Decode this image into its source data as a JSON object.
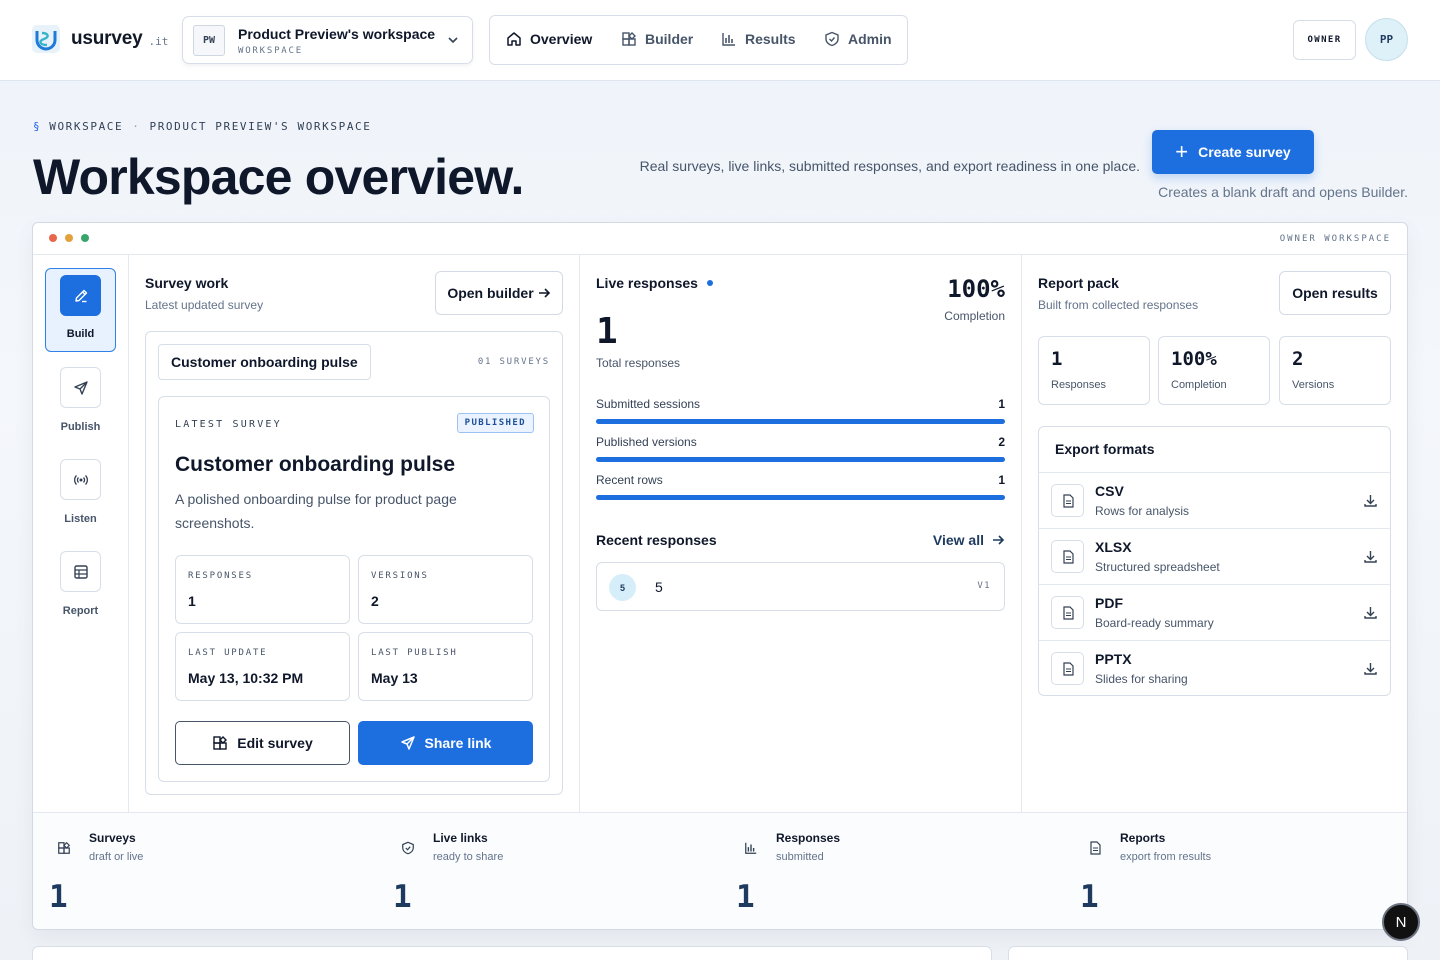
{
  "brand": {
    "name": "usurvey",
    "tld": ".it"
  },
  "workspace_switcher": {
    "initials": "PW",
    "name": "Product Preview's workspace",
    "caption": "WORKSPACE"
  },
  "nav": [
    {
      "label": "Overview",
      "icon": "home-icon",
      "active": true
    },
    {
      "label": "Builder",
      "icon": "blocks-icon",
      "active": false
    },
    {
      "label": "Results",
      "icon": "bar-chart-icon",
      "active": false
    },
    {
      "label": "Admin",
      "icon": "shield-icon",
      "active": false
    }
  ],
  "user": {
    "role": "OWNER",
    "initials": "PP"
  },
  "header": {
    "crumb_symbol": "§",
    "crumb_1": "WORKSPACE",
    "crumb_sep": "·",
    "crumb_2": "PRODUCT PREVIEW'S WORKSPACE",
    "title": "Workspace overview.",
    "description": "Real surveys, live links, submitted responses, and export readiness in one place.",
    "create_button": "Create survey",
    "create_hint": "Creates a blank draft and opens Builder."
  },
  "frame": {
    "label": "OWNER WORKSPACE",
    "window_dot_colors": [
      "#e8674a",
      "#e3a13b",
      "#3aa56b"
    ]
  },
  "rail": [
    {
      "label": "Build",
      "icon": "pencil-icon",
      "active": true
    },
    {
      "label": "Publish",
      "icon": "send-icon",
      "active": false
    },
    {
      "label": "Listen",
      "icon": "broadcast-icon",
      "active": false
    },
    {
      "label": "Report",
      "icon": "table-icon",
      "active": false
    }
  ],
  "survey_work": {
    "title": "Survey work",
    "subtitle": "Latest updated survey",
    "open_builder": "Open builder",
    "chip": "Customer onboarding pulse",
    "count": "01 SURVEYS",
    "latest": {
      "eyebrow": "LATEST SURVEY",
      "status": "PUBLISHED",
      "name": "Customer onboarding pulse",
      "description": "A polished onboarding pulse for product page screenshots.",
      "stats": [
        {
          "key": "RESPONSES",
          "value": "1"
        },
        {
          "key": "VERSIONS",
          "value": "2"
        },
        {
          "key": "LAST UPDATE",
          "value": "May 13, 10:32 PM"
        },
        {
          "key": "LAST PUBLISH",
          "value": "May 13"
        }
      ],
      "edit_button": "Edit survey",
      "share_button": "Share link"
    }
  },
  "live": {
    "title": "Live responses",
    "completion": "100%",
    "completion_label": "Completion",
    "total": "1",
    "total_label": "Total responses",
    "metrics": [
      {
        "name": "Submitted sessions",
        "value": "1",
        "fill": 1.0
      },
      {
        "name": "Published versions",
        "value": "2",
        "fill": 1.0
      },
      {
        "name": "Recent rows",
        "value": "1",
        "fill": 1.0
      }
    ],
    "recent_title": "Recent responses",
    "view_all": "View all",
    "recent": [
      {
        "badge": "5",
        "id": "5",
        "version": "V1"
      }
    ]
  },
  "report": {
    "title": "Report pack",
    "subtitle": "Built from collected responses",
    "open_results": "Open results",
    "tiles": [
      {
        "value": "1",
        "label": "Responses"
      },
      {
        "value": "100%",
        "label": "Completion"
      },
      {
        "value": "2",
        "label": "Versions"
      }
    ],
    "export_title": "Export formats",
    "formats": [
      {
        "name": "CSV",
        "desc": "Rows for analysis"
      },
      {
        "name": "XLSX",
        "desc": "Structured spreadsheet"
      },
      {
        "name": "PDF",
        "desc": "Board-ready summary"
      },
      {
        "name": "PPTX",
        "desc": "Slides for sharing"
      }
    ]
  },
  "bottom_stats": [
    {
      "title": "Surveys",
      "sub": "draft or live",
      "value": "1",
      "icon": "blocks-icon"
    },
    {
      "title": "Live links",
      "sub": "ready to share",
      "value": "1",
      "icon": "shield-icon"
    },
    {
      "title": "Responses",
      "sub": "submitted",
      "value": "1",
      "icon": "bar-chart-icon"
    },
    {
      "title": "Reports",
      "sub": "export from results",
      "value": "1",
      "icon": "file-icon"
    }
  ],
  "fab_label": "N"
}
